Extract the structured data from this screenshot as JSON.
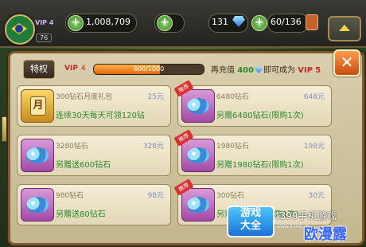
{
  "topbar": {
    "vip_label": "VIP 4",
    "level_badge": "76",
    "gold": "1,008,709",
    "gems": "131",
    "stamina": "60/136"
  },
  "panel": {
    "privilege_button": "特权",
    "vip_label": "VIP",
    "vip_level": "4",
    "progress_text": "600/1000",
    "progress_fraction": 0.6,
    "recharge_prefix": "再充值",
    "recharge_amount": "400",
    "recharge_suffix": "即可成为",
    "next_vip_label": "VIP",
    "next_vip_level": "5",
    "close_label": "✕"
  },
  "items": [
    {
      "name": "300钻石月度礼包",
      "price": "25元",
      "desc": "连续30天每天可领120钻",
      "icon": "month-card-icon",
      "tag": ""
    },
    {
      "name": "6480钻石",
      "price": "648元",
      "desc": "另赠6480钻石(限购1次)",
      "icon": "diamond-pile-icon",
      "tag": "推荐"
    },
    {
      "name": "3280钻石",
      "price": "328元",
      "desc": "另赠送600钻石",
      "icon": "diamond-pile-icon",
      "tag": ""
    },
    {
      "name": "1980钻石",
      "price": "198元",
      "desc": "另赠1980钻石(限购1次)",
      "icon": "diamond-pile-icon",
      "tag": "推荐"
    },
    {
      "name": "980钻石",
      "price": "98元",
      "desc": "另赠送80钻石",
      "icon": "diamond-pile-icon",
      "tag": ""
    },
    {
      "name": "300钻石",
      "price": "30元",
      "desc": "另赠300钻石(限购1次)",
      "icon": "diamond-pile-icon",
      "tag": "推荐"
    }
  ],
  "watermark": {
    "logo_line1": "游戏",
    "logo_line2": "大全",
    "site_text": "4399手机游戏",
    "site_url": "www.4399.cn",
    "corner_text": "欧漫露"
  },
  "colors": {
    "panel_bg": "#d9cfae",
    "desc_green": "#2a8a2a",
    "vip_red": "#c02a2a",
    "price_blue": "#7b8fc0"
  }
}
